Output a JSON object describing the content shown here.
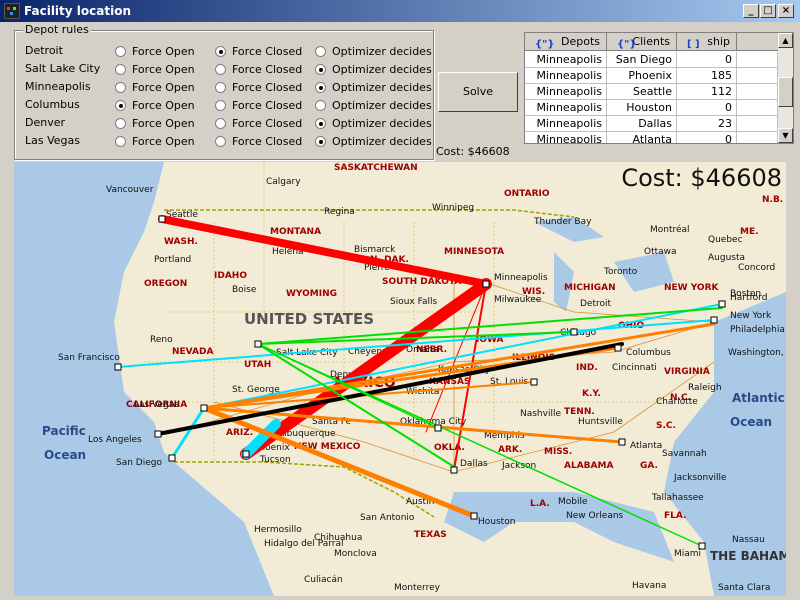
{
  "window": {
    "title": "Facility location",
    "minimize": "_",
    "maximize": "□",
    "close": "×"
  },
  "depot_rules": {
    "legend": "Depot rules",
    "option_labels": [
      "Force Open",
      "Force Closed",
      "Optimizer decides"
    ],
    "rows": [
      {
        "name": "Detroit",
        "selected": 1
      },
      {
        "name": "Salt Lake City",
        "selected": 2
      },
      {
        "name": "Minneapolis",
        "selected": 2
      },
      {
        "name": "Columbus",
        "selected": 0
      },
      {
        "name": "Denver",
        "selected": 2
      },
      {
        "name": "Las Vegas",
        "selected": 2
      }
    ]
  },
  "solve_button": "Solve",
  "cost_small": "Cost: $46608",
  "cost_big": "Cost: $46608",
  "grid": {
    "columns": [
      {
        "icon": "{\"}",
        "label": "Depots"
      },
      {
        "icon": "{\"}",
        "label": "Clients"
      },
      {
        "icon": "[ ]",
        "label": "ship"
      }
    ],
    "rows": [
      [
        "Minneapolis",
        "San Diego",
        "0"
      ],
      [
        "Minneapolis",
        "Phoenix",
        "185"
      ],
      [
        "Minneapolis",
        "Seattle",
        "112"
      ],
      [
        "Minneapolis",
        "Houston",
        "0"
      ],
      [
        "Minneapolis",
        "Dallas",
        "23"
      ],
      [
        "Minneapolis",
        "Atlanta",
        "0"
      ]
    ]
  },
  "map": {
    "country_labels": [
      "UNITED STATES",
      "MEXICO",
      "THE BAHAMAS",
      "Pacific",
      "Ocean",
      "Atlantic",
      "Ocean"
    ],
    "region_labels": [
      "WASH.",
      "OREGON",
      "IDAHO",
      "MONTANA",
      "WYOMING",
      "NEVADA",
      "UTAH",
      "CALIFORNIA",
      "ARIZ.",
      "NEW MEXICO",
      "TEXAS",
      "OKLA.",
      "KANSAS",
      "NEBR.",
      "SOUTH DAKOTA",
      "N. DAK.",
      "MINNESOTA",
      "IOWA",
      "WIS.",
      "MICHIGAN",
      "ILLINOIS",
      "IND.",
      "OHIO",
      "K.Y.",
      "TENN.",
      "ARK.",
      "MISS.",
      "ALABAMA",
      "GA.",
      "S.C.",
      "N.C.",
      "VIRGINIA",
      "FLA.",
      "L.A.",
      "NEW YORK",
      "ME.",
      "N.B.",
      "SASKATCHEWAN",
      "ONTARIO"
    ],
    "city_labels": [
      "Vancouver",
      "Calgary",
      "Regina",
      "Winnipeg",
      "Thunder Bay",
      "Montréal",
      "Ottawa",
      "Quebec",
      "Augusta",
      "Concord",
      "Boston",
      "Hartford",
      "Toronto",
      "Seattle",
      "Portland",
      "Helena",
      "Boise",
      "Bismarck",
      "Pierre",
      "Sioux Falls",
      "Minneapolis",
      "Milwaukee",
      "Detroit",
      "Chicago",
      "New York",
      "Philadelphia",
      "Washington, D.C.",
      "Columbus",
      "Cincinnati",
      "Reno",
      "San Francisco",
      "Salt Lake City",
      "Cheyenne",
      "Omaha",
      "Denver",
      "Kansas City",
      "St. Louis",
      "Wichita",
      "St. George",
      "Las Vegas",
      "Los Angeles",
      "San Diego",
      "Phoenix",
      "Santa Fe",
      "Albuquerque",
      "Oklahoma City",
      "Memphis",
      "Nashville",
      "Huntsville",
      "Atlanta",
      "Charlotte",
      "Raleigh",
      "Savannah",
      "Jacksonville",
      "Tallahassee",
      "Miami",
      "Nassau",
      "Dallas",
      "Jackson",
      "Mobile",
      "New Orleans",
      "Austin",
      "Houston",
      "San Antonio",
      "Hermosillo",
      "Hidalgo del Parral",
      "Chihuahua",
      "Monclova",
      "Culiacán",
      "Monterrey",
      "Havana",
      "Santa Clara",
      "Tucson"
    ]
  },
  "colors": {
    "minneapolis": "#ff0000",
    "columbus": "#ff8000",
    "detroit": "#00e000",
    "lasvegas": "#00e0ff",
    "saltlake": "#000000",
    "title_start": "#0a246a",
    "title_end": "#a6caf0"
  }
}
